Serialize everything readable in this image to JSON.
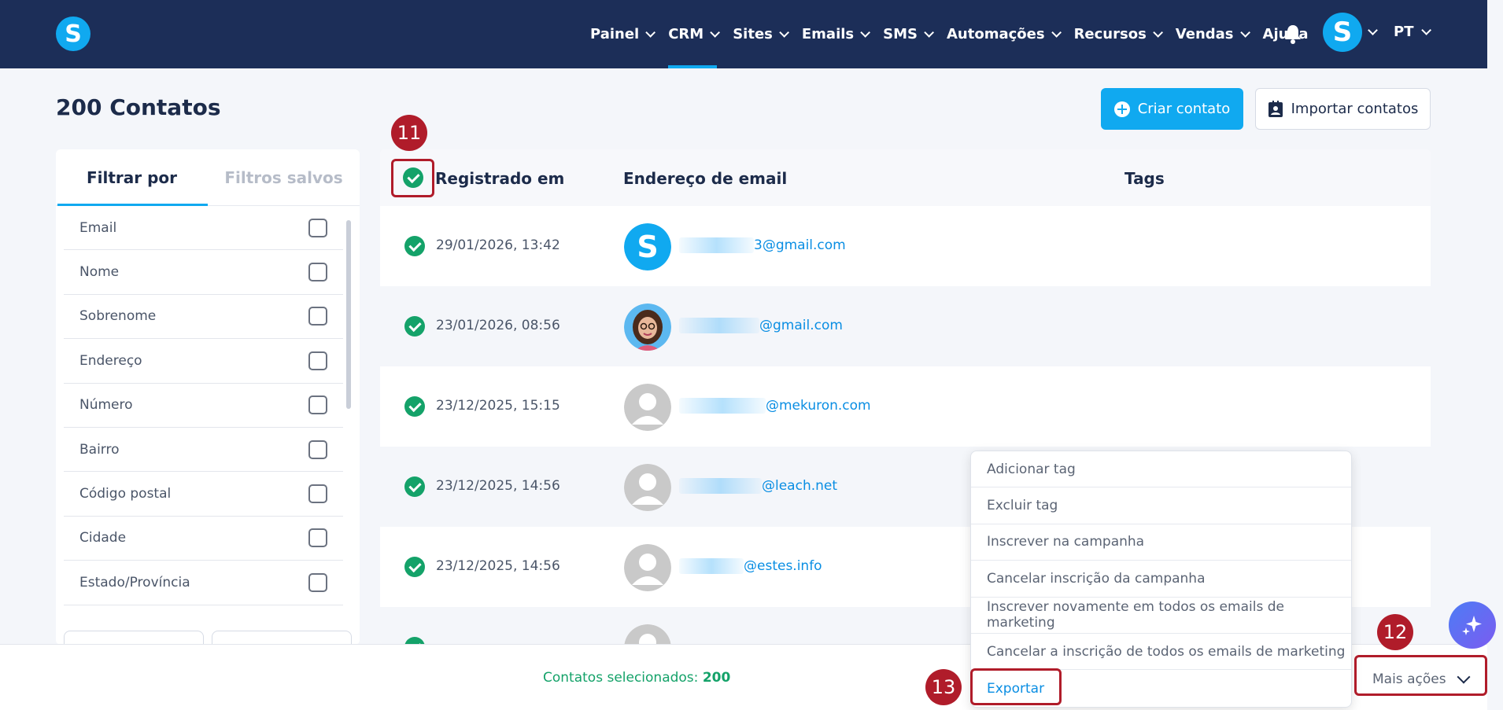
{
  "nav": {
    "logo": "S",
    "items": [
      {
        "label": "Painel",
        "chevron": true
      },
      {
        "label": "CRM",
        "chevron": true,
        "active": true
      },
      {
        "label": "Sites",
        "chevron": true
      },
      {
        "label": "Emails",
        "chevron": true
      },
      {
        "label": "SMS",
        "chevron": true
      },
      {
        "label": "Automações",
        "chevron": true
      },
      {
        "label": "Recursos",
        "chevron": true
      },
      {
        "label": "Vendas",
        "chevron": true
      },
      {
        "label": "Ajuda",
        "chevron": false
      }
    ],
    "avatar_letter": "S",
    "language": "PT"
  },
  "page": {
    "title": "200 Contatos",
    "create_button": "Criar contato",
    "import_button": "Importar contatos"
  },
  "filters": {
    "tabs": [
      "Filtrar por",
      "Filtros salvos"
    ],
    "fields": [
      "Email",
      "Nome",
      "Sobrenome",
      "Endereço",
      "Número",
      "Bairro",
      "Código postal",
      "Cidade",
      "Estado/Província"
    ]
  },
  "table": {
    "headers": {
      "registered": "Registrado em",
      "email": "Endereço de email",
      "tags": "Tags"
    },
    "rows": [
      {
        "date": "29/01/2026, 13:42",
        "email_domain": "3@gmail.com",
        "avatar": "brand-s"
      },
      {
        "date": "23/01/2026, 08:56",
        "email_domain": "@gmail.com",
        "avatar": "photo"
      },
      {
        "date": "23/12/2025, 15:15",
        "email_domain": "@mekuron.com",
        "avatar": "placeholder"
      },
      {
        "date": "23/12/2025, 14:56",
        "email_domain": "@leach.net",
        "avatar": "placeholder"
      },
      {
        "date": "23/12/2025, 14:56",
        "email_domain": "@estes.info",
        "avatar": "placeholder"
      },
      {
        "date": "",
        "email_domain": "",
        "avatar": "placeholder"
      }
    ]
  },
  "dropdown": {
    "items": [
      "Adicionar tag",
      "Excluir tag",
      "Inscrever na campanha",
      "Cancelar inscrição da campanha",
      "Inscrever novamente em todos os emails de marketing",
      "Cancelar a inscrição de todos os emails de marketing",
      "Exportar"
    ]
  },
  "bottom": {
    "selected_label": "Contatos selecionados:",
    "selected_count": "200",
    "more_actions": "Mais ações"
  },
  "annotations": {
    "step_a": "11",
    "step_b": "12",
    "step_c": "13"
  },
  "colors": {
    "nav_bg": "#1c2e58",
    "accent": "#10a9f0",
    "success": "#14a269",
    "annotation": "#b01c2a"
  }
}
